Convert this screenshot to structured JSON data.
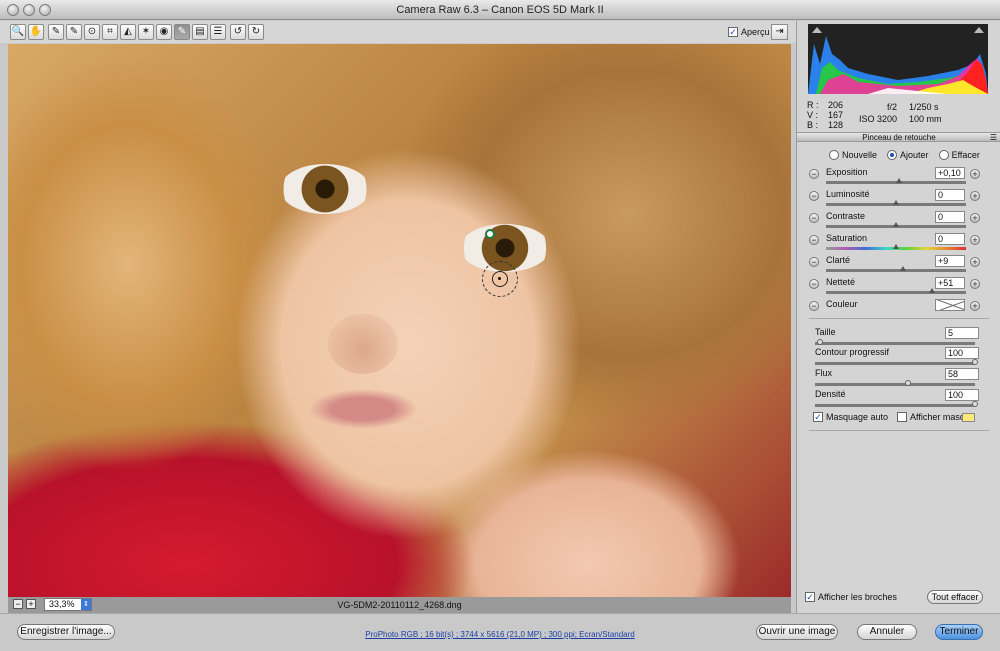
{
  "window": {
    "title": "Camera Raw 6.3  –  Canon EOS 5D Mark II"
  },
  "toolbar": {
    "tools": [
      {
        "icon": "zoom-icon",
        "glyph": "🔍"
      },
      {
        "icon": "hand-icon",
        "glyph": "✋"
      },
      {
        "icon": "white-balance-icon",
        "glyph": "✎"
      },
      {
        "icon": "color-sampler-icon",
        "glyph": "✎"
      },
      {
        "icon": "targeted-adjustment-icon",
        "glyph": "⊙"
      },
      {
        "icon": "crop-icon",
        "glyph": "⌗"
      },
      {
        "icon": "straighten-icon",
        "glyph": "◭"
      },
      {
        "icon": "spot-removal-icon",
        "glyph": "✶"
      },
      {
        "icon": "red-eye-icon",
        "glyph": "◉"
      },
      {
        "icon": "adjustment-brush-icon",
        "glyph": "✎"
      },
      {
        "icon": "graduated-filter-icon",
        "glyph": "▤"
      },
      {
        "icon": "preferences-icon",
        "glyph": "☰"
      },
      {
        "icon": "rotate-left-icon",
        "glyph": "↺"
      },
      {
        "icon": "rotate-right-icon",
        "glyph": "↻"
      }
    ],
    "preview_label": "Aperçu",
    "preview_checked": "✓",
    "fullscreen_glyph": "⇥"
  },
  "status": {
    "zoom_out": "−",
    "zoom_in": "+",
    "zoom": "33,3%",
    "zoom_arrow": "⇕",
    "filename": "VG-5DM2-20110112_4268.dng"
  },
  "readout": {
    "r_label": "R :",
    "r_value": "206",
    "v_label": "V :",
    "v_value": "167",
    "b_label": "B :",
    "b_value": "128",
    "aperture": "f/2",
    "shutter": "1/250 s",
    "iso": "ISO 3200",
    "focal": "100 mm"
  },
  "brush_panel": {
    "title": "Pinceau de retouche",
    "menu_glyph": "☰",
    "modes": [
      "Nouvelle",
      "Ajouter",
      "Effacer"
    ],
    "selected_mode": "Ajouter",
    "minus": "−",
    "plus": "+",
    "adjustments": [
      {
        "label": "Exposition",
        "value": "+0,10",
        "level": 0.52
      },
      {
        "label": "Luminosité",
        "value": "0",
        "level": 0.5
      },
      {
        "label": "Contraste",
        "value": "0",
        "level": 0.5
      },
      {
        "label": "Saturation",
        "value": "0",
        "level": 0.5
      },
      {
        "label": "Clarté",
        "value": "+9",
        "level": 0.55
      },
      {
        "label": "Netteté",
        "value": "+51",
        "level": 0.76
      }
    ],
    "color_label": "Couleur",
    "brush_params": [
      {
        "label": "Taille",
        "value": "5",
        "level": 0.03
      },
      {
        "label": "Contour progressif",
        "value": "100",
        "level": 1.0
      },
      {
        "label": "Flux",
        "value": "58",
        "level": 0.58
      },
      {
        "label": "Densité",
        "value": "100",
        "level": 1.0
      }
    ],
    "auto_mask_label": "Masquage auto",
    "auto_mask_checked": "✓",
    "show_mask_label": "Afficher masque",
    "show_pins_label": "Afficher les broches",
    "show_pins_checked": "✓",
    "clear_all_label": "Tout effacer"
  },
  "bottom": {
    "save_label": "Enregistrer l'image...",
    "workflow": "ProPhoto RGB ; 16 bit(s) ; 3744 x 5616 (21,0 MP) ; 300 ppi; Ecran/Standard",
    "open_label": "Ouvrir une image",
    "cancel_label": "Annuler",
    "done_label": "Terminer"
  },
  "colors": {
    "accent": "#4c93e0",
    "mask_overlay": "#ffe87a",
    "pin": "#1d7a3f"
  }
}
